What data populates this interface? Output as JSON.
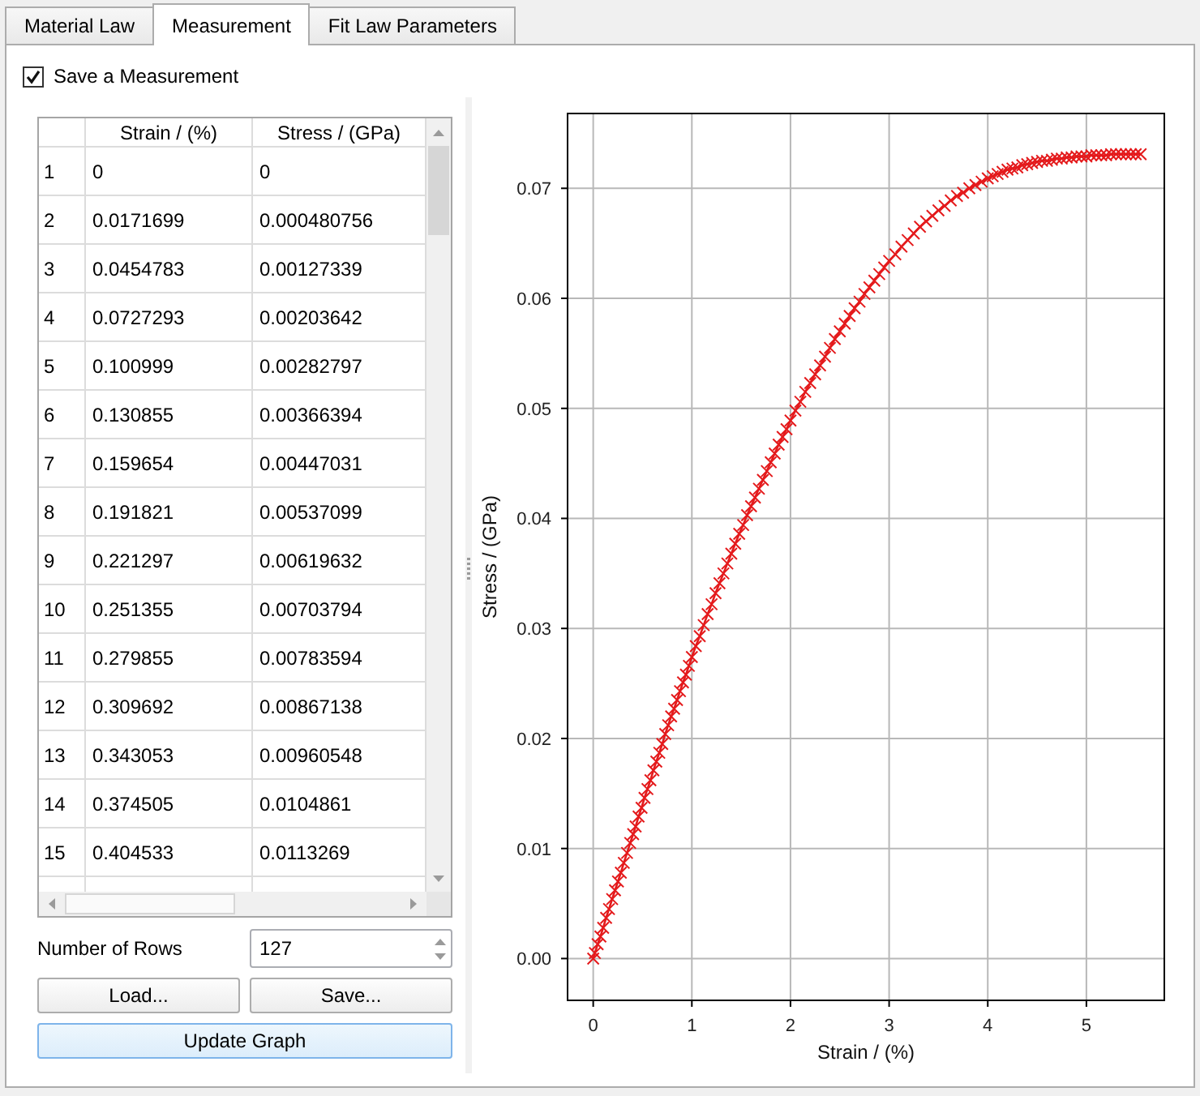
{
  "tabs": [
    {
      "label": "Material Law",
      "selected": false
    },
    {
      "label": "Measurement",
      "selected": true
    },
    {
      "label": "Fit Law Parameters",
      "selected": false
    }
  ],
  "save_measurement": {
    "label": "Save a Measurement",
    "checked": true
  },
  "table": {
    "columns": [
      "Strain / (%)",
      "Stress / (GPa)"
    ],
    "rows": [
      {
        "index": "1",
        "cells": [
          "0",
          "0"
        ]
      },
      {
        "index": "2",
        "cells": [
          "0.0171699",
          "0.000480756"
        ]
      },
      {
        "index": "3",
        "cells": [
          "0.0454783",
          "0.00127339"
        ]
      },
      {
        "index": "4",
        "cells": [
          "0.0727293",
          "0.00203642"
        ]
      },
      {
        "index": "5",
        "cells": [
          "0.100999",
          "0.00282797"
        ]
      },
      {
        "index": "6",
        "cells": [
          "0.130855",
          "0.00366394"
        ]
      },
      {
        "index": "7",
        "cells": [
          "0.159654",
          "0.00447031"
        ]
      },
      {
        "index": "8",
        "cells": [
          "0.191821",
          "0.00537099"
        ]
      },
      {
        "index": "9",
        "cells": [
          "0.221297",
          "0.00619632"
        ]
      },
      {
        "index": "10",
        "cells": [
          "0.251355",
          "0.00703794"
        ]
      },
      {
        "index": "11",
        "cells": [
          "0.279855",
          "0.00783594"
        ]
      },
      {
        "index": "12",
        "cells": [
          "0.309692",
          "0.00867138"
        ]
      },
      {
        "index": "13",
        "cells": [
          "0.343053",
          "0.00960548"
        ]
      },
      {
        "index": "14",
        "cells": [
          "0.374505",
          "0.0104861"
        ]
      },
      {
        "index": "15",
        "cells": [
          "0.404533",
          "0.0113269"
        ]
      }
    ]
  },
  "number_of_rows": {
    "label": "Number of Rows",
    "value": "127"
  },
  "buttons": [
    {
      "label": "Load...",
      "default": false
    },
    {
      "label": "Save...",
      "default": false
    },
    {
      "label": "Update Graph",
      "default": true
    }
  ],
  "plot": {
    "chart_data": {
      "type": "line",
      "grid": true,
      "xlabel": "Strain / (%)",
      "ylabel": "Stress / (GPa)",
      "x": [
        0,
        0.017,
        0.045,
        0.073,
        0.101,
        0.131,
        0.16,
        0.192,
        0.221,
        0.251,
        0.28,
        0.31,
        0.343,
        0.375,
        0.405,
        0.43,
        0.46,
        0.49,
        0.52,
        0.55,
        0.58,
        0.61,
        0.64,
        0.67,
        0.7,
        0.73,
        0.76,
        0.79,
        0.82,
        0.85,
        0.88,
        0.91,
        0.94,
        0.97,
        1,
        1.04,
        1.08,
        1.12,
        1.16,
        1.2,
        1.24,
        1.28,
        1.32,
        1.36,
        1.4,
        1.44,
        1.48,
        1.52,
        1.56,
        1.6,
        1.64,
        1.68,
        1.72,
        1.76,
        1.8,
        1.84,
        1.88,
        1.92,
        1.96,
        2,
        2.05,
        2.1,
        2.15,
        2.2,
        2.25,
        2.3,
        2.35,
        2.4,
        2.45,
        2.5,
        2.55,
        2.6,
        2.65,
        2.7,
        2.75,
        2.8,
        2.85,
        2.9,
        2.95,
        3,
        3.063,
        3.125,
        3.188,
        3.25,
        3.313,
        3.375,
        3.438,
        3.5,
        3.563,
        3.625,
        3.688,
        3.75,
        3.813,
        3.875,
        3.938,
        4,
        4.05,
        4.1,
        4.15,
        4.2,
        4.25,
        4.3,
        4.35,
        4.4,
        4.45,
        4.5,
        4.55,
        4.6,
        4.65,
        4.7,
        4.75,
        4.8,
        4.85,
        4.9,
        4.95,
        5,
        5.05,
        5.1,
        5.15,
        5.2,
        5.25,
        5.3,
        5.35,
        5.4,
        5.45,
        5.5,
        5.55
      ],
      "series": [
        {
          "color": "#e41a1c",
          "marker": "x",
          "values": [
            0,
            0.0005,
            0.0013,
            0.002,
            0.0028,
            0.0037,
            0.0045,
            0.0054,
            0.0062,
            0.007,
            0.0078,
            0.0087,
            0.0096,
            0.0105,
            0.0113,
            0.012,
            0.0129,
            0.0137,
            0.0146,
            0.0154,
            0.0162,
            0.0171,
            0.0179,
            0.0187,
            0.0195,
            0.0204,
            0.0212,
            0.022,
            0.0227,
            0.0235,
            0.0243,
            0.0251,
            0.0258,
            0.0266,
            0.0274,
            0.0284,
            0.0293,
            0.0303,
            0.0313,
            0.0322,
            0.0332,
            0.0341,
            0.035,
            0.0359,
            0.0368,
            0.0377,
            0.0386,
            0.0394,
            0.0403,
            0.0411,
            0.0419,
            0.0427,
            0.0435,
            0.0443,
            0.0451,
            0.0459,
            0.0467,
            0.0474,
            0.0481,
            0.0489,
            0.0498,
            0.0506,
            0.0515,
            0.0523,
            0.0531,
            0.0539,
            0.0547,
            0.0555,
            0.0563,
            0.057,
            0.0577,
            0.0584,
            0.0591,
            0.0597,
            0.0604,
            0.061,
            0.0616,
            0.0622,
            0.0628,
            0.0634,
            0.064,
            0.0647,
            0.0653,
            0.0659,
            0.0665,
            0.067,
            0.0675,
            0.068,
            0.0684,
            0.0689,
            0.0693,
            0.0696,
            0.07,
            0.0703,
            0.0706,
            0.0709,
            0.0711,
            0.0713,
            0.0715,
            0.0717,
            0.0718,
            0.0719,
            0.0721,
            0.0722,
            0.0723,
            0.0724,
            0.0725,
            0.0725,
            0.0726,
            0.0727,
            0.0727,
            0.0728,
            0.0728,
            0.0729,
            0.0729,
            0.0729,
            0.073,
            0.073,
            0.073,
            0.073,
            0.0731,
            0.0731,
            0.0731,
            0.0731,
            0.0731,
            0.0731,
            0.0731
          ]
        }
      ],
      "xlim": [
        -0.26,
        5.79
      ],
      "ylim": [
        -0.0038,
        0.0768
      ],
      "xticks": [
        0,
        1,
        2,
        3,
        4,
        5
      ],
      "yticks": [
        {
          "value": 0,
          "label": "0.00"
        },
        {
          "value": 0.01,
          "label": "0.01"
        },
        {
          "value": 0.02,
          "label": "0.02"
        },
        {
          "value": 0.03,
          "label": "0.03"
        },
        {
          "value": 0.04,
          "label": "0.04"
        },
        {
          "value": 0.05,
          "label": "0.05"
        },
        {
          "value": 0.06,
          "label": "0.06"
        },
        {
          "value": 0.07,
          "label": "0.07"
        }
      ]
    }
  }
}
